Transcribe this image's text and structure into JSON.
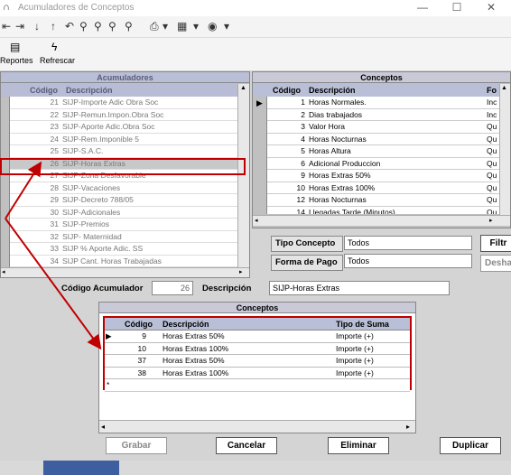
{
  "window": {
    "title": "Acumuladores de Conceptos",
    "minimize": "—",
    "maximize": "☐",
    "close": "✕"
  },
  "toolbar": {
    "reportes_label": "Reportes",
    "refrescar_label": "Refrescar"
  },
  "left_panel": {
    "title": "Acumuladores",
    "columns": [
      "Código",
      "Descripción"
    ],
    "rows": [
      {
        "code": "21",
        "desc": "SIJP-Importe Adic Obra Soc"
      },
      {
        "code": "22",
        "desc": "SIJP-Remun.Impon.Obra Soc"
      },
      {
        "code": "23",
        "desc": "SIJP-Aporte Adic.Obra Soc"
      },
      {
        "code": "24",
        "desc": "SIJP-Rem.Imponible 5"
      },
      {
        "code": "25",
        "desc": "SIJP-S.A.C."
      },
      {
        "code": "26",
        "desc": "SIJP-Horas Extras"
      },
      {
        "code": "27",
        "desc": "SIJP-Zona Desfavorable"
      },
      {
        "code": "28",
        "desc": "SIJP-Vacaciones"
      },
      {
        "code": "29",
        "desc": "SIJP-Decreto 788/05"
      },
      {
        "code": "30",
        "desc": "SIJP-Adicionales"
      },
      {
        "code": "31",
        "desc": "SIJP-Premios"
      },
      {
        "code": "32",
        "desc": "SIJP- Maternidad"
      },
      {
        "code": "33",
        "desc": "SIJP % Aporte Adic. SS"
      },
      {
        "code": "34",
        "desc": "SIJP Cant. Horas Trabajadas"
      }
    ]
  },
  "right_panel": {
    "title": "Conceptos",
    "columns": [
      "Código",
      "Descripción",
      "Fo"
    ],
    "rows": [
      {
        "code": "1",
        "desc": "Horas Normales.",
        "fo": "Inc"
      },
      {
        "code": "2",
        "desc": "Dias trabajados",
        "fo": "Inc"
      },
      {
        "code": "3",
        "desc": "Valor Hora",
        "fo": "Qu"
      },
      {
        "code": "4",
        "desc": "Horas Nocturnas",
        "fo": "Qu"
      },
      {
        "code": "5",
        "desc": "Horas Altura",
        "fo": "Qu"
      },
      {
        "code": "6",
        "desc": "Adicional Produccion",
        "fo": "Qu"
      },
      {
        "code": "9",
        "desc": "Horas Extras 50%",
        "fo": "Qu"
      },
      {
        "code": "10",
        "desc": "Horas Extras 100%",
        "fo": "Qu"
      },
      {
        "code": "12",
        "desc": "Horas Nocturnas",
        "fo": "Qu"
      },
      {
        "code": "14",
        "desc": "Llegadas Tarde (Minutos)",
        "fo": "Qu"
      }
    ]
  },
  "filters": {
    "tipo_label": "Tipo Concepto",
    "tipo_value": "Todos",
    "forma_label": "Forma de Pago",
    "forma_value": "Todos",
    "filtrar_label": "Filtr",
    "deshacer_label": "Desha"
  },
  "detail": {
    "codigo_label": "Código Acumulador",
    "codigo_value": "26",
    "desc_label": "Descripción",
    "desc_value": "SIJP-Horas Extras"
  },
  "bottom_panel": {
    "title": "Conceptos",
    "columns": [
      "Código",
      "Descripción",
      "Tipo de Suma"
    ],
    "rows": [
      {
        "code": "9",
        "desc": "Horas Extras 50%",
        "tipo": "Importe (+)"
      },
      {
        "code": "10",
        "desc": "Horas Extras 100%",
        "tipo": "Importe (+)"
      },
      {
        "code": "37",
        "desc": "Horas Extras 50%",
        "tipo": "Importe (+)"
      },
      {
        "code": "38",
        "desc": "Horas Extras 100%",
        "tipo": "Importe (+)"
      }
    ],
    "new_row_marker": "*"
  },
  "buttons": {
    "grabar": "Grabar",
    "cancelar": "Cancelar",
    "eliminar": "Eliminar",
    "duplicar": "Duplicar"
  },
  "colors": {
    "highlight": "#c00000",
    "grid_header": "#b8bcd4",
    "panel_bg": "#c0c0c0"
  }
}
